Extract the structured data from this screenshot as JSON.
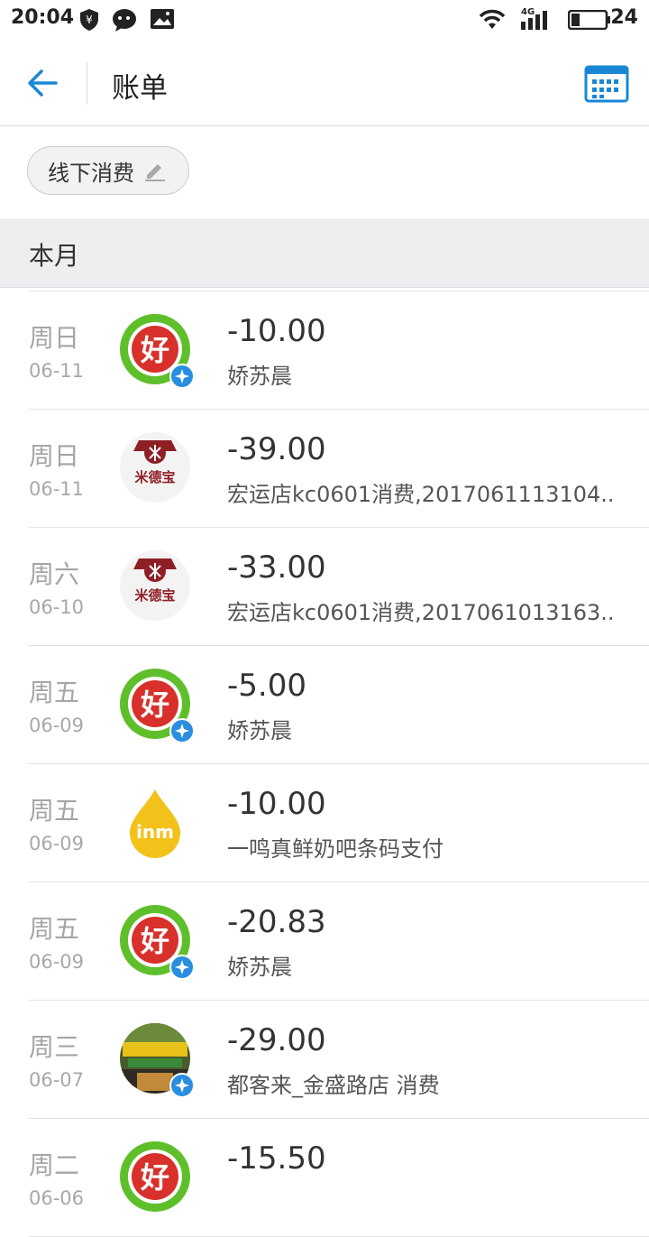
{
  "status_bar": {
    "time": "20:04",
    "network": "4G",
    "battery": "24"
  },
  "header": {
    "title": "账单"
  },
  "filter": {
    "chip_label": "线下消费"
  },
  "section": {
    "title": "本月"
  },
  "transactions": [
    {
      "day": "周日",
      "date": "06-11",
      "amount": "-10.00",
      "desc": "娇苏晨",
      "logo": "hao-logo"
    },
    {
      "day": "周日",
      "date": "06-11",
      "amount": "-39.00",
      "desc": "宏运店kc0601消费,2017061113104..",
      "logo": "midebao-logo"
    },
    {
      "day": "周六",
      "date": "06-10",
      "amount": "-33.00",
      "desc": "宏运店kc0601消费,2017061013163..",
      "logo": "midebao-logo"
    },
    {
      "day": "周五",
      "date": "06-09",
      "amount": "-5.00",
      "desc": "娇苏晨",
      "logo": "hao-logo"
    },
    {
      "day": "周五",
      "date": "06-09",
      "amount": "-10.00",
      "desc": "一鸣真鲜奶吧条码支付",
      "logo": "inm-logo"
    },
    {
      "day": "周五",
      "date": "06-09",
      "amount": "-20.83",
      "desc": "娇苏晨",
      "logo": "hao-logo"
    },
    {
      "day": "周三",
      "date": "06-07",
      "amount": "-29.00",
      "desc": "都客来_金盛路店 消费",
      "logo": "store-photo"
    },
    {
      "day": "周二",
      "date": "06-06",
      "amount": "-15.50",
      "desc": "",
      "logo": "hao-logo"
    }
  ],
  "logo_text": {
    "midebao": "米德宝",
    "inm": "inm",
    "hao": "好"
  },
  "colors": {
    "accent": "#1a87d6",
    "hao_green": "#5fbf2a",
    "hao_red": "#d8302a",
    "inm_yellow": "#f3c21a",
    "midebao_red": "#8e1f25"
  }
}
